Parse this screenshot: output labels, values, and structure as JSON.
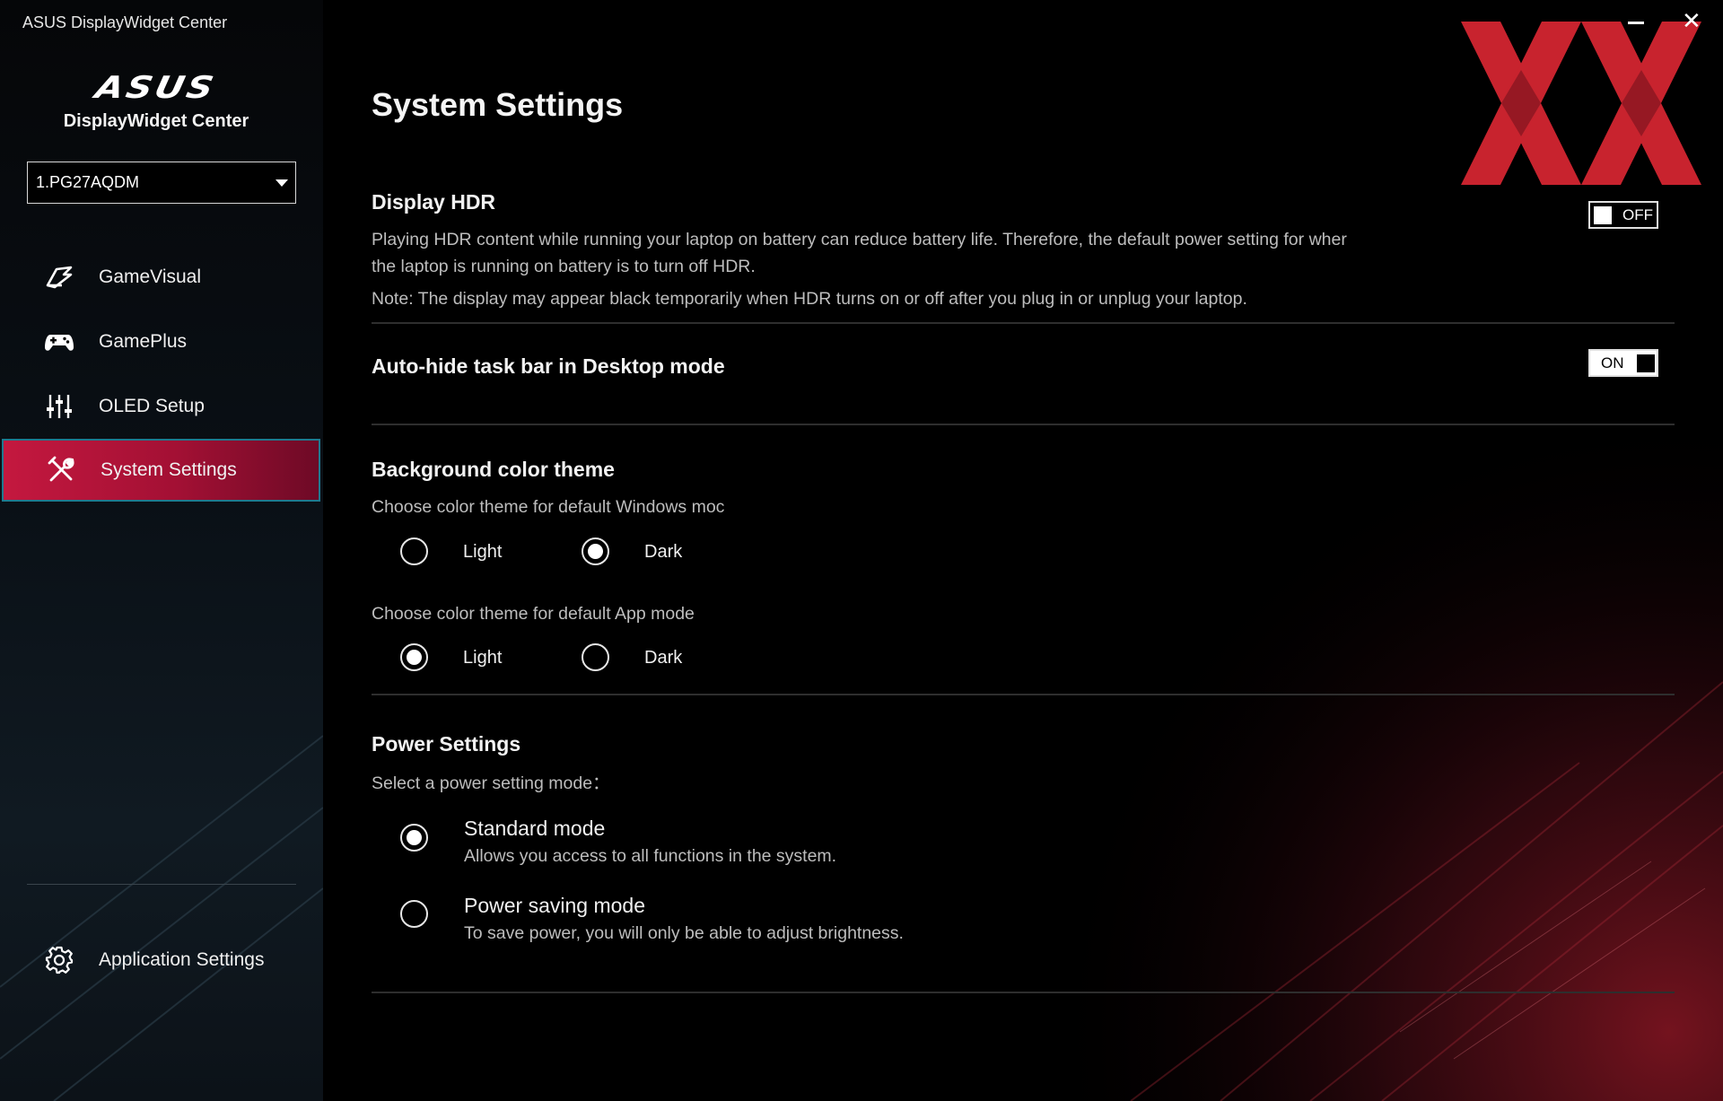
{
  "window": {
    "title": "ASUS DisplayWidget Center",
    "controls": {
      "minimize": "—",
      "close": "✕"
    }
  },
  "sidebar": {
    "logo_text": "ASUS",
    "app_name": "DisplayWidget Center",
    "monitor_select": {
      "value": "1.PG27AQDM"
    },
    "items": [
      {
        "label": "GameVisual",
        "icon": "gamevisual-icon",
        "active": false
      },
      {
        "label": "GamePlus",
        "icon": "gamepad-icon",
        "active": false
      },
      {
        "label": "OLED Setup",
        "icon": "sliders-icon",
        "active": false
      },
      {
        "label": "System Settings",
        "icon": "tools-icon",
        "active": true
      }
    ],
    "footer_item": {
      "label": "Application Settings",
      "icon": "gear-icon"
    }
  },
  "main": {
    "page_title": "System Settings",
    "display_hdr": {
      "title": "Display HDR",
      "desc_line1": "Playing HDR content while running your laptop on battery can reduce battery life. Therefore, the default power setting for wher",
      "desc_line2": "the laptop is running on battery is to turn off HDR.",
      "note": "Note: The display may appear black temporarily when HDR turns on or off after you plug in or unplug your laptop.",
      "toggle_label": "OFF",
      "enabled": false
    },
    "auto_hide": {
      "title": "Auto-hide task bar in Desktop mode",
      "toggle_label": "ON",
      "enabled": true
    },
    "background_theme": {
      "title": "Background color theme",
      "windows_prompt": "Choose color theme for default Windows moc",
      "windows_options": [
        "Light",
        "Dark"
      ],
      "windows_selected": "Dark",
      "app_prompt": "Choose color theme for default App mode",
      "app_options": [
        "Light",
        "Dark"
      ],
      "app_selected": "Light"
    },
    "power": {
      "title": "Power Settings",
      "prompt": "Select a power setting mode：",
      "modes": [
        {
          "title": "Standard mode",
          "desc": "Allows you access to all functions in the system.",
          "selected": true
        },
        {
          "title": "Power saving mode",
          "desc": "To save power, you will only be able to adjust brightness.",
          "selected": false
        }
      ]
    }
  },
  "colors": {
    "accent_active": "#c4183f",
    "active_border": "#1e7a8f",
    "logo_red": "#c8232e"
  }
}
